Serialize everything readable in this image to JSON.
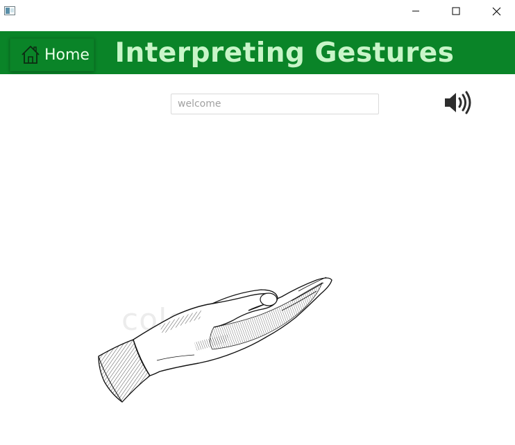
{
  "window": {
    "controls": {
      "minimize_icon": "minimize-icon",
      "maximize_icon": "maximize-icon",
      "close_icon": "close-icon"
    }
  },
  "header": {
    "background_color": "#0a8428",
    "title_color": "#c8f5c8",
    "home_button": {
      "label": "Home",
      "icon": "home-icon"
    },
    "title": "Interpreting Gestures"
  },
  "main": {
    "text_field": {
      "placeholder": "welcome",
      "value": ""
    },
    "speaker_icon": "speaker-icon",
    "gesture_image": {
      "description_icon": "open-hand-icon",
      "watermark": "colou"
    }
  }
}
